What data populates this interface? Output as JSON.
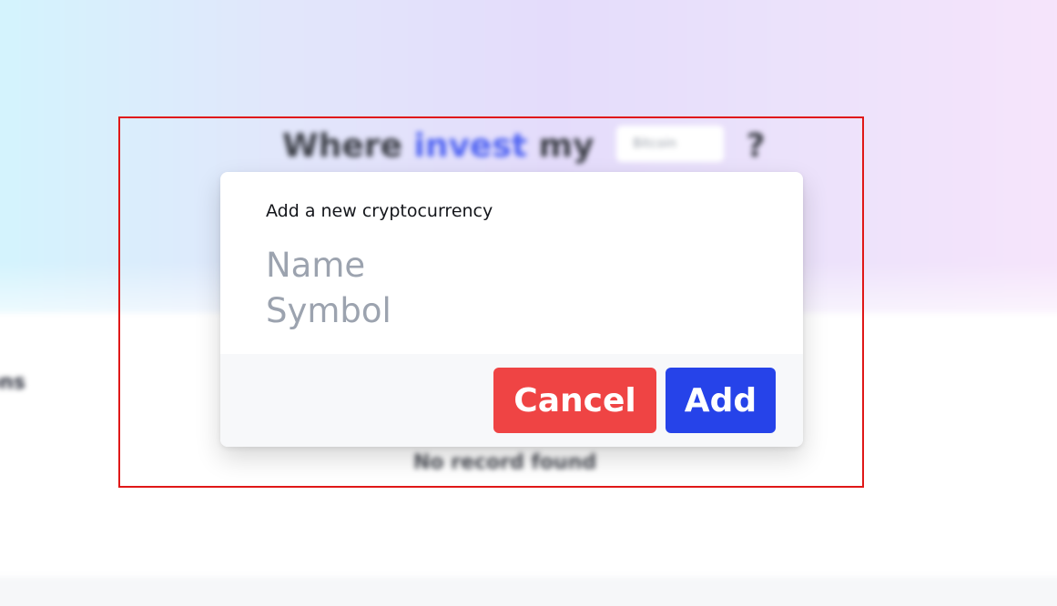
{
  "background": {
    "headline_prefix": "Where",
    "headline_accent": "invest",
    "headline_middle": "my",
    "amount_select_value": "Bitcoin",
    "headline_suffix": "?",
    "side_label": "ons",
    "empty_state": "No record found"
  },
  "modal": {
    "title": "Add a new cryptocurrency",
    "name_field": {
      "value": "",
      "placeholder": "Name"
    },
    "symbol_field": {
      "value": "",
      "placeholder": "Symbol"
    },
    "cancel_label": "Cancel",
    "add_label": "Add"
  },
  "colors": {
    "cancel": "#ef4444",
    "add": "#2643e9",
    "accent": "#4f63f2",
    "highlight_frame": "#e01818"
  }
}
